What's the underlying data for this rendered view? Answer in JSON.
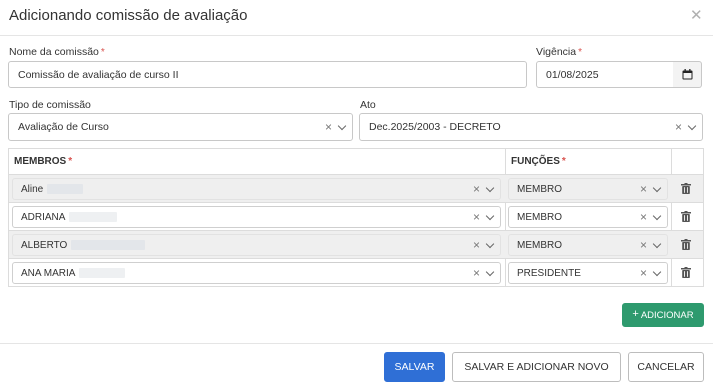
{
  "dialog": {
    "title": "Adicionando comissão de avaliação"
  },
  "form": {
    "nome_label": "Nome da comissão",
    "nome_value": "Comissão de avaliação de curso II",
    "vigencia_label": "Vigência",
    "vigencia_value": "01/08/2025",
    "tipo_label": "Tipo de comissão",
    "tipo_value": "Avaliação de Curso",
    "ato_label": "Ato",
    "ato_value": "Dec.2025/2003 - DECRETO",
    "required_mark": "*"
  },
  "table": {
    "col_membros": "MEMBROS",
    "col_funcoes": "FUNÇÕES",
    "rows": [
      {
        "membro": "Aline",
        "funcao": "MEMBRO"
      },
      {
        "membro": "ADRIANA",
        "funcao": "MEMBRO"
      },
      {
        "membro": "ALBERTO",
        "funcao": "MEMBRO"
      },
      {
        "membro": "ANA MARIA",
        "funcao": "PRESIDENTE"
      }
    ]
  },
  "actions": {
    "adicionar_label": "ADICIONAR",
    "salvar_label": "SALVAR",
    "salvar_novo_label": "SALVAR E ADICIONAR NOVO",
    "cancelar_label": "CANCELAR"
  },
  "colors": {
    "primary": "#2f6fd6",
    "success": "#2e9a6e",
    "required": "#d9534f"
  }
}
